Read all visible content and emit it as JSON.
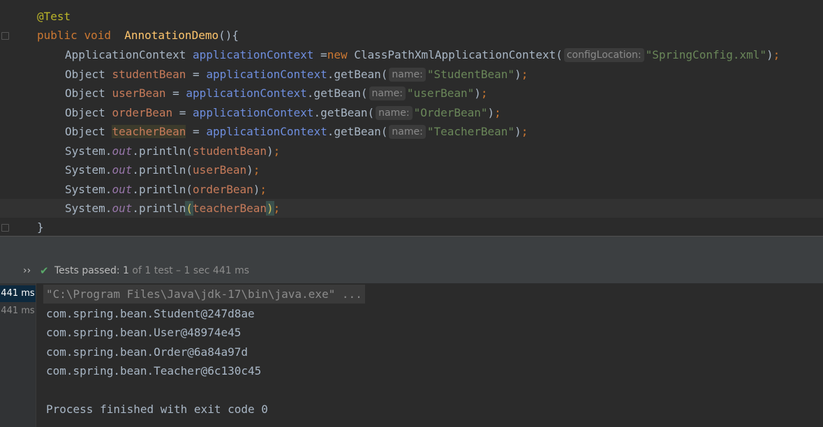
{
  "editor": {
    "annotation": "@Test",
    "method_decl": {
      "kw_public": "public",
      "kw_void": "void",
      "method_name": "AnnotationDemo",
      "parens": "()",
      "brace_open": "{"
    },
    "line_app": {
      "type": "ApplicationContext",
      "var": "applicationContext",
      "assign": " =",
      "kw_new": "new",
      "ctor": " ClassPathXmlApplicationContext(",
      "hint": "configLocation:",
      "arg": "\"SpringConfig.xml\"",
      "close": ")",
      "semi": ";"
    },
    "bean_lines": [
      {
        "type": "Object",
        "var": "studentBean",
        "assign": " = ",
        "ref": "applicationContext",
        "call": ".getBean(",
        "hint": "name:",
        "arg": "\"StudentBean\"",
        "close": ")",
        "semi": ";"
      },
      {
        "type": "Object",
        "var": "userBean",
        "assign": " = ",
        "ref": "applicationContext",
        "call": ".getBean(",
        "hint": "name:",
        "arg": "\"userBean\"",
        "close": ")",
        "semi": ";"
      },
      {
        "type": "Object",
        "var": "orderBean",
        "assign": " = ",
        "ref": "applicationContext",
        "call": ".getBean(",
        "hint": "name:",
        "arg": "\"OrderBean\"",
        "close": ")",
        "semi": ";"
      },
      {
        "type": "Object",
        "var": "teacherBean",
        "assign": " = ",
        "ref": "applicationContext",
        "call": ".getBean(",
        "hint": "name:",
        "arg": "\"TeacherBean\"",
        "close": ")",
        "semi": ";"
      }
    ],
    "print_lines": [
      {
        "sys": "System.",
        "field": "out",
        "method": ".println(",
        "arg": "studentBean",
        "close": ")",
        "semi": ";"
      },
      {
        "sys": "System.",
        "field": "out",
        "method": ".println(",
        "arg": "userBean",
        "close": ")",
        "semi": ";"
      },
      {
        "sys": "System.",
        "field": "out",
        "method": ".println(",
        "arg": "orderBean",
        "close": ")",
        "semi": ";"
      },
      {
        "sys": "System.",
        "field": "out",
        "method": ".println",
        "open": "(",
        "arg": "teacherBean",
        "close": ")",
        "semi": ";"
      }
    ],
    "brace_close": "}"
  },
  "run": {
    "chevron": "››",
    "status_label": "Tests passed: ",
    "passed_count": "1",
    "status_rest": " of 1 test – 1 sec 441 ms"
  },
  "console": {
    "times": [
      "441 ms",
      "441 ms"
    ],
    "command": "\"C:\\Program Files\\Java\\jdk-17\\bin\\java.exe\" ...",
    "output": [
      "com.spring.bean.Student@247d8ae",
      "com.spring.bean.User@48974e45",
      "com.spring.bean.Order@6a84a97d",
      "com.spring.bean.Teacher@6c130c45"
    ],
    "exit": "Process finished with exit code 0"
  },
  "colors": {
    "editor_bg": "#2b2b2b",
    "keyword": "#cc7832",
    "string": "#6a8759",
    "function": "#ffc66d",
    "success": "#59a869"
  }
}
